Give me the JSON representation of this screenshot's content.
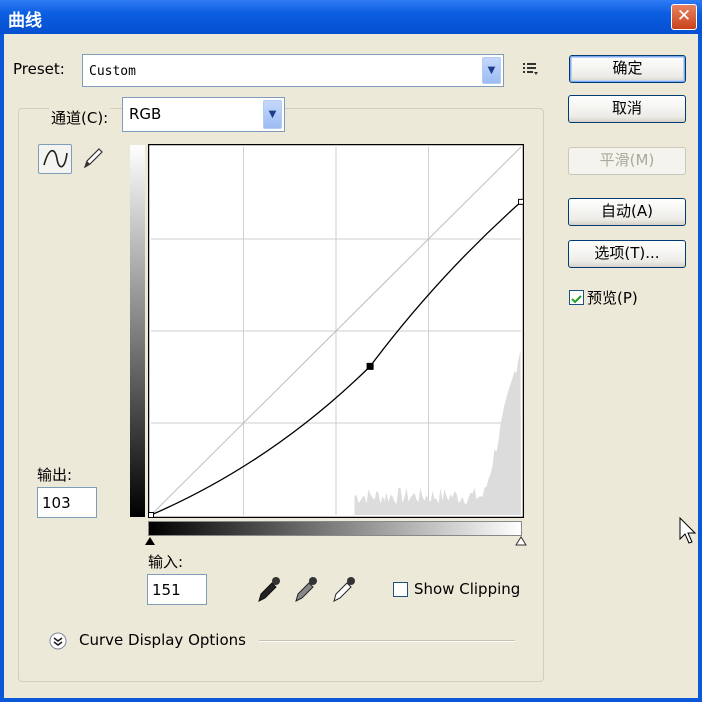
{
  "window": {
    "title": "曲线",
    "close_glyph": "✕"
  },
  "preset": {
    "label": "Preset:",
    "value": "Custom"
  },
  "channel": {
    "label": "通道(C):",
    "value": "RGB"
  },
  "buttons": {
    "ok": "确定",
    "cancel": "取消",
    "smooth": "平滑(M)",
    "auto": "自动(A)",
    "options": "选项(T)..."
  },
  "preview": {
    "label": "预览(P)",
    "checked": true
  },
  "output": {
    "label": "输出:",
    "value": "103"
  },
  "input": {
    "label": "输入:",
    "value": "151"
  },
  "show_clipping": {
    "label": "Show Clipping",
    "checked": false
  },
  "curve_display": {
    "label": "Curve Display Options"
  },
  "curve": {
    "points": [
      [
        0,
        0
      ],
      [
        151,
        103
      ],
      [
        255,
        217
      ]
    ]
  },
  "colors": {
    "title_bar": "#0a58d8",
    "dialog_bg": "#ece9d8",
    "curve": "#000000"
  },
  "icons": [
    "curve-tool-icon",
    "pencil-icon",
    "preset-menu-icon",
    "black-eyedropper-icon",
    "gray-eyedropper-icon",
    "white-eyedropper-icon",
    "expand-icon",
    "mouse-cursor-icon"
  ]
}
